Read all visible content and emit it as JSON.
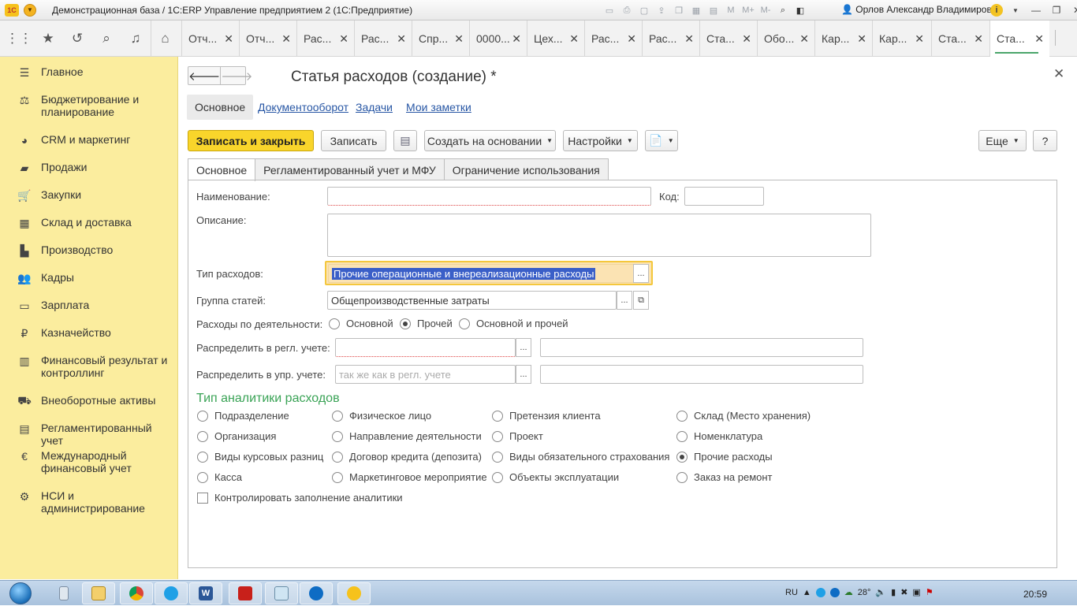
{
  "window": {
    "title": "Демонстрационная база / 1С:ERP Управление предприятием 2  (1С:Предприятие)",
    "user": "Орлов Александр Владимирович",
    "logo_text": "1С",
    "toolbar_icons": [
      "save-icon",
      "print-icon",
      "preview-icon",
      "upload-icon",
      "copy-icon",
      "calculator-icon",
      "calendar-icon",
      "memory-m-icon",
      "memory-m-plus-icon",
      "memory-m-minus-icon",
      "zoom-icon",
      "layout-icon"
    ],
    "memory_labels": [
      "M",
      "M+",
      "M-"
    ]
  },
  "tabs": [
    {
      "label": "Отч...",
      "active": false
    },
    {
      "label": "Отч...",
      "active": false
    },
    {
      "label": "Рас...",
      "active": false
    },
    {
      "label": "Рас...",
      "active": false
    },
    {
      "label": "Спр...",
      "active": false
    },
    {
      "label": "0000...",
      "active": false
    },
    {
      "label": "Цех...",
      "active": false
    },
    {
      "label": "Рас...",
      "active": false
    },
    {
      "label": "Рас...",
      "active": false
    },
    {
      "label": "Ста...",
      "active": false
    },
    {
      "label": "Обо...",
      "active": false
    },
    {
      "label": "Кар...",
      "active": false
    },
    {
      "label": "Кар...",
      "active": false
    },
    {
      "label": "Ста...",
      "active": false
    },
    {
      "label": "Ста...",
      "active": true
    }
  ],
  "sidebar": {
    "items": [
      {
        "label": "Главное",
        "icon": "menu-icon"
      },
      {
        "label": "Бюджетирование и планирование",
        "icon": "budget-icon"
      },
      {
        "label": "CRM и маркетинг",
        "icon": "pie-icon"
      },
      {
        "label": "Продажи",
        "icon": "bag-icon"
      },
      {
        "label": "Закупки",
        "icon": "cart-icon"
      },
      {
        "label": "Склад и доставка",
        "icon": "warehouse-icon"
      },
      {
        "label": "Производство",
        "icon": "factory-icon"
      },
      {
        "label": "Кадры",
        "icon": "people-icon"
      },
      {
        "label": "Зарплата",
        "icon": "wallet-icon"
      },
      {
        "label": "Казначейство",
        "icon": "ruble-icon"
      },
      {
        "label": "Финансовый результат и контроллинг",
        "icon": "chart-icon"
      },
      {
        "label": "Внеоборотные активы",
        "icon": "truck-icon"
      },
      {
        "label": "Регламентированный учет",
        "icon": "report-icon"
      },
      {
        "label": "Международный финансовый учет",
        "icon": "euro-icon"
      },
      {
        "label": "НСИ и администрирование",
        "icon": "gear-icon"
      }
    ]
  },
  "form": {
    "title": "Статья расходов (создание) *",
    "nav_tabs": [
      "Основное",
      "Документооборот",
      "Задачи",
      "Мои заметки"
    ],
    "buttons": {
      "save_close": "Записать и закрыть",
      "save": "Записать",
      "create_based": "Создать на основании",
      "settings": "Настройки",
      "more": "Еще",
      "help": "?"
    },
    "page_tabs": [
      "Основное",
      "Регламентированный учет и МФУ",
      "Ограничение использования"
    ],
    "fields": {
      "name_label": "Наименование:",
      "name_value": "",
      "code_label": "Код:",
      "code_value": "",
      "description_label": "Описание:",
      "description_value": "",
      "expense_type_label": "Тип расходов:",
      "expense_type_value": "Прочие операционные и внереализационные расходы",
      "group_label": "Группа статей:",
      "group_value": "Общепроизводственные затраты",
      "activity_label": "Расходы по деятельности:",
      "activity_options": [
        {
          "label": "Основной",
          "checked": false
        },
        {
          "label": "Прочей",
          "checked": true
        },
        {
          "label": "Основной и прочей",
          "checked": false
        }
      ],
      "distribute_reg_label": "Распределить в регл. учете:",
      "distribute_reg_value": "",
      "distribute_mgmt_label": "Распределить в упр. учете:",
      "distribute_mgmt_placeholder": "так же как в регл. учете"
    },
    "analytics": {
      "section_title": "Тип аналитики расходов",
      "options": [
        {
          "label": "Подразделение",
          "checked": false
        },
        {
          "label": "Физическое лицо",
          "checked": false
        },
        {
          "label": "Претензия клиента",
          "checked": false
        },
        {
          "label": "Склад (Место хранения)",
          "checked": false
        },
        {
          "label": "Организация",
          "checked": false
        },
        {
          "label": "Направление деятельности",
          "checked": false
        },
        {
          "label": "Проект",
          "checked": false
        },
        {
          "label": "Номенклатура",
          "checked": false
        },
        {
          "label": "Виды курсовых разниц",
          "checked": false
        },
        {
          "label": "Договор кредита (депозита)",
          "checked": false
        },
        {
          "label": "Виды обязательного страхования",
          "checked": false
        },
        {
          "label": "Прочие расходы",
          "checked": true
        },
        {
          "label": "Касса",
          "checked": false
        },
        {
          "label": "Маркетинговое мероприятие",
          "checked": false
        },
        {
          "label": "Объекты эксплуатации",
          "checked": false
        },
        {
          "label": "Заказ на ремонт",
          "checked": false
        }
      ],
      "control_label": "Контролировать заполнение аналитики",
      "control_checked": false
    }
  },
  "taskbar": {
    "lang": "RU",
    "temperature": "28°",
    "time": "20:59",
    "apps": [
      "file-manager-icon",
      "explorer-icon",
      "chrome-icon",
      "skype-icon",
      "word-icon",
      "pdf-icon",
      "notepad-icon",
      "teamviewer-icon",
      "1c-icon"
    ]
  },
  "colors": {
    "sidebar_bg": "#fbed9e",
    "primary_button": "#f9d52b",
    "accent_green": "#3aa356",
    "link_blue": "#2857a5",
    "selection_blue": "#3a5fc8"
  }
}
